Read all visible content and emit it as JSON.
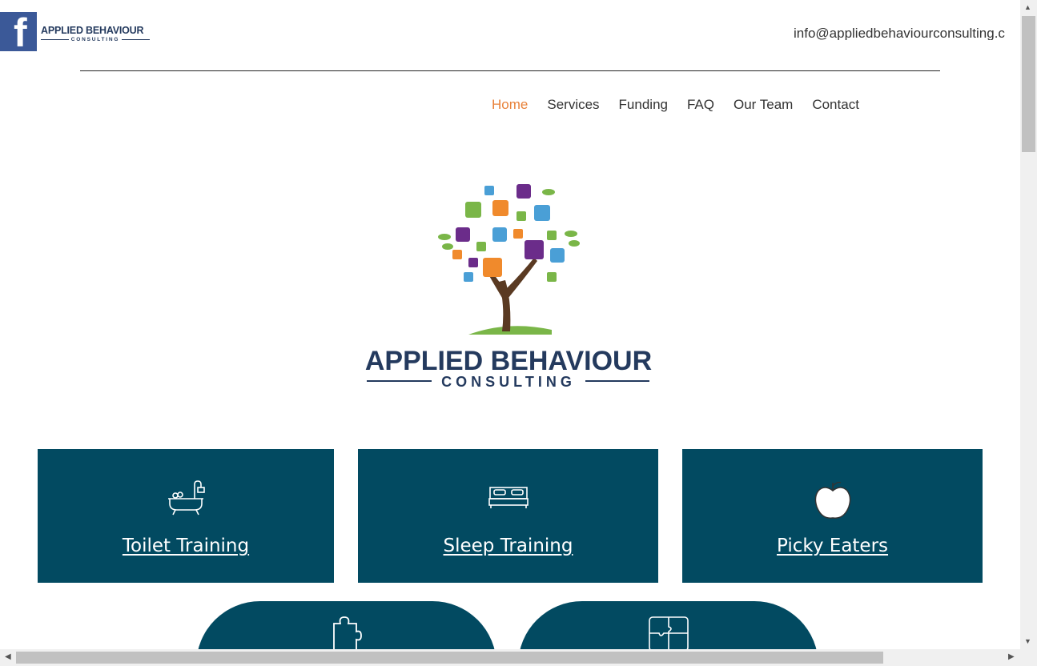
{
  "header": {
    "facebook_icon": "facebook-icon",
    "logo_line1": "APPLIED BEHAVIOUR",
    "logo_line2": "CONSULTING",
    "email": "info@appliedbehaviourconsulting.c"
  },
  "nav": {
    "items": [
      {
        "label": "Home",
        "active": true
      },
      {
        "label": "Services"
      },
      {
        "label": "Funding"
      },
      {
        "label": "FAQ"
      },
      {
        "label": "Our Team"
      },
      {
        "label": "Contact"
      }
    ]
  },
  "hero": {
    "brand_line1": "APPLIED BEHAVIOUR",
    "brand_line2": "CONSULTING"
  },
  "cards": [
    {
      "label": "Toilet Training",
      "icon": "bathtub-icon"
    },
    {
      "label": "Sleep Training",
      "icon": "bed-icon"
    },
    {
      "label": "Picky Eaters",
      "icon": "apple-icon"
    }
  ],
  "pills": [
    {
      "icon": "puzzle-piece-icon"
    },
    {
      "icon": "puzzle-grid-icon"
    }
  ],
  "colors": {
    "accent": "#e8823a",
    "card_bg": "#024a61",
    "brand_navy": "#243a5e"
  }
}
